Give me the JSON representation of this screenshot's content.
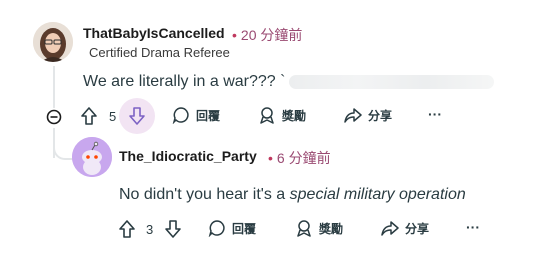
{
  "comment": {
    "username": "ThatBabyIsCancelled",
    "time": "20 分鐘前",
    "flair": "Certified Drama Referee",
    "body": "We are literally in a war??? `",
    "score": "5",
    "reply_label": "回覆",
    "award_label": "獎勵",
    "share_label": "分享",
    "more_label": "···"
  },
  "reply": {
    "username": "The_Idiocratic_Party",
    "time": "6 分鐘前",
    "body_plain": "No didn't you hear it's a ",
    "body_italic": "special military operation",
    "score": "3",
    "reply_label": "回覆",
    "award_label": "獎勵",
    "share_label": "分享",
    "more_label": "···"
  },
  "colors": {
    "accent_downvote": "#7c62c4",
    "time_color": "#9a4a72",
    "avatar_reply_bg": "#c8a7ee"
  }
}
